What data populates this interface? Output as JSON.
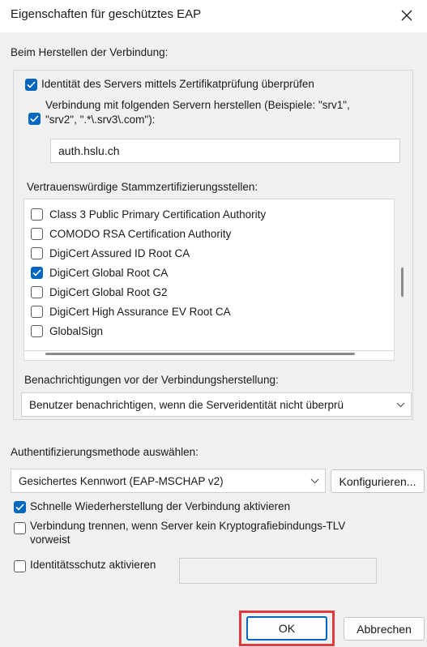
{
  "window": {
    "title": "Eigenschaften für geschütztes EAP",
    "close_icon": "close-icon"
  },
  "connection": {
    "heading": "Beim Herstellen der Verbindung:",
    "verify_identity": {
      "label": "Identität des Servers mittels Zertifikatprüfung überprüfen",
      "checked": true
    },
    "connect_servers": {
      "label_line1": "Verbindung mit folgenden Servern herstellen (Beispiele: \"srv1\",",
      "label_line2": "\"srv2\", \".*\\.srv3\\.com\"):",
      "checked": true
    },
    "server_value": "auth.hslu.ch",
    "ca_heading": "Vertrauenswürdige Stammzertifizierungsstellen:",
    "ca_list": [
      {
        "label": "Class 3 Public Primary Certification Authority",
        "checked": false
      },
      {
        "label": "COMODO RSA Certification Authority",
        "checked": false
      },
      {
        "label": "DigiCert Assured ID Root CA",
        "checked": false
      },
      {
        "label": "DigiCert Global Root CA",
        "checked": true
      },
      {
        "label": "DigiCert Global Root G2",
        "checked": false
      },
      {
        "label": "DigiCert High Assurance EV Root CA",
        "checked": false
      },
      {
        "label": "GlobalSign",
        "checked": false
      }
    ],
    "notify_heading": "Benachrichtigungen vor der Verbindungsherstellung:",
    "notify_value": "Benutzer benachrichtigen, wenn die Serveridentität nicht überprü"
  },
  "auth": {
    "heading": "Authentifizierungsmethode auswählen:",
    "method_value": "Gesichertes Kennwort (EAP-MSCHAP v2)",
    "configure_label": "Konfigurieren...",
    "fast_reconnect": {
      "label": "Schnelle Wiederherstellung der Verbindung aktivieren",
      "checked": true
    },
    "disconnect": {
      "label_line1": "Verbindung trennen, wenn Server kein Kryptografiebindungs-TLV",
      "label_line2": "vorweist",
      "checked": false
    },
    "identity_privacy": {
      "label": "Identitätsschutz aktivieren",
      "checked": false,
      "value": ""
    }
  },
  "buttons": {
    "ok_label": "OK",
    "cancel_label": "Abbrechen",
    "highlight_color": "#e0393e"
  },
  "colors": {
    "accent": "#0067c0",
    "dialog_bg": "#f0f0f0"
  }
}
